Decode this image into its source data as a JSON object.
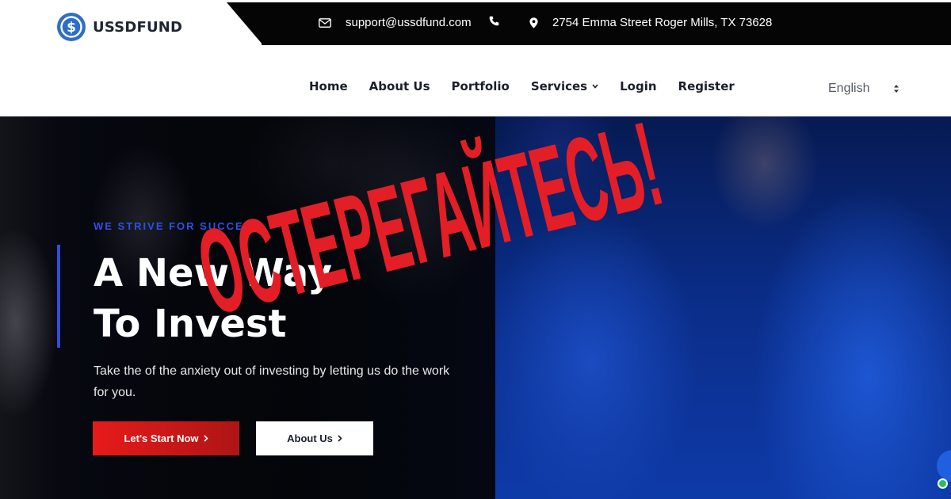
{
  "brand": {
    "name": "USSDFUND",
    "logo_color": "#2d6ec7",
    "logo_icon": "dollar-coin-icon"
  },
  "topbar": {
    "email": "support@ussdfund.com",
    "address": "2754 Emma Street Roger Mills, TX 73628",
    "icons": [
      "envelope-icon",
      "phone-icon",
      "map-pin-icon"
    ]
  },
  "nav": {
    "items": [
      {
        "label": "Home"
      },
      {
        "label": "About Us"
      },
      {
        "label": "Portfolio"
      },
      {
        "label": "Services",
        "has_dropdown": true
      },
      {
        "label": "Login"
      },
      {
        "label": "Register"
      }
    ],
    "language": "English"
  },
  "hero": {
    "tagline": "WE STRIVE FOR SUCCESS",
    "headline_line1": "A New Way",
    "headline_line2": "To Invest",
    "subtext": "Take the of the anxiety out of investing by letting us do the work for you.",
    "primary_button": "Let's Start Now",
    "secondary_button": "About Us",
    "accent_color": "#2f50e8",
    "primary_color": "#e71a1a"
  },
  "overlay": {
    "warning_text": "ОСТЕРЕГАЙТЕСЬ!",
    "color": "#e41e26"
  }
}
